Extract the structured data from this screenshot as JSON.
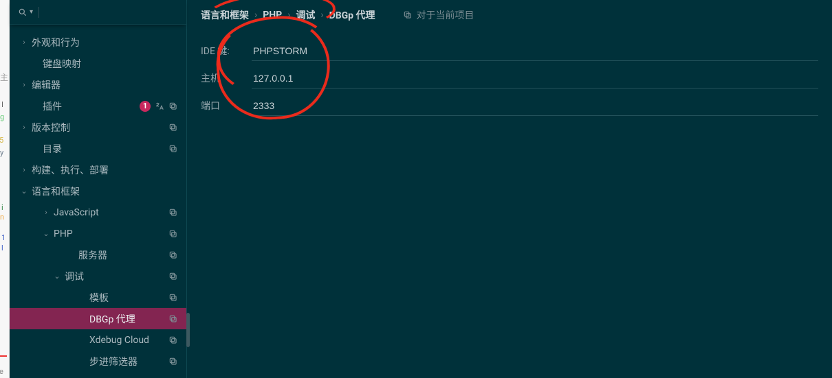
{
  "sidebar": {
    "badge": "1",
    "items": [
      {
        "label": "外观和行为",
        "chev": ">",
        "pad": "pad-0",
        "trail": []
      },
      {
        "label": "键盘映射",
        "chev": "",
        "pad": "no-chev pad-1",
        "trail": []
      },
      {
        "label": "编辑器",
        "chev": ">",
        "pad": "pad-0",
        "trail": []
      },
      {
        "label": "插件",
        "chev": "",
        "pad": "no-chev pad-1",
        "trail": [
          "badge",
          "lang",
          "copy"
        ]
      },
      {
        "label": "版本控制",
        "chev": ">",
        "pad": "pad-0",
        "trail": [
          "copy"
        ]
      },
      {
        "label": "目录",
        "chev": "",
        "pad": "no-chev pad-1",
        "trail": [
          "copy"
        ]
      },
      {
        "label": "构建、执行、部署",
        "chev": ">",
        "pad": "pad-0",
        "trail": []
      },
      {
        "label": "语言和框架",
        "chev": "v",
        "pad": "pad-0",
        "trail": []
      },
      {
        "label": "JavaScript",
        "chev": ">",
        "pad": "pad-2",
        "trail": [
          "copy"
        ]
      },
      {
        "label": "PHP",
        "chev": "v",
        "pad": "pad-2",
        "trail": [
          "copy"
        ]
      },
      {
        "label": "服务器",
        "chev": "",
        "pad": "no-chev pad-4",
        "trail": [
          "copy"
        ]
      },
      {
        "label": "调试",
        "chev": "v",
        "pad": "pad-3",
        "trail": [
          "copy"
        ]
      },
      {
        "label": "模板",
        "chev": "",
        "pad": "no-chev pad-4b",
        "trail": [
          "copy"
        ]
      },
      {
        "label": "DBGp 代理",
        "chev": "",
        "pad": "no-chev pad-4b",
        "trail": [
          "copy"
        ],
        "sel": true
      },
      {
        "label": "Xdebug Cloud",
        "chev": "",
        "pad": "no-chev pad-4b",
        "trail": [
          "copy"
        ]
      },
      {
        "label": "步进筛选器",
        "chev": "",
        "pad": "no-chev pad-4b",
        "trail": [
          "copy"
        ]
      }
    ]
  },
  "breadcrumb": [
    "语言和框架",
    "PHP",
    "调试",
    "DBGp 代理"
  ],
  "forProject": "对于当前项目",
  "form": {
    "ideKey": {
      "label": "IDE 键:",
      "value": "PHPSTORM"
    },
    "host": {
      "label": "主机",
      "value": "127.0.0.1"
    },
    "port": {
      "label": "端口",
      "value": "2333"
    }
  },
  "gutter": {
    "lbl": "主"
  }
}
